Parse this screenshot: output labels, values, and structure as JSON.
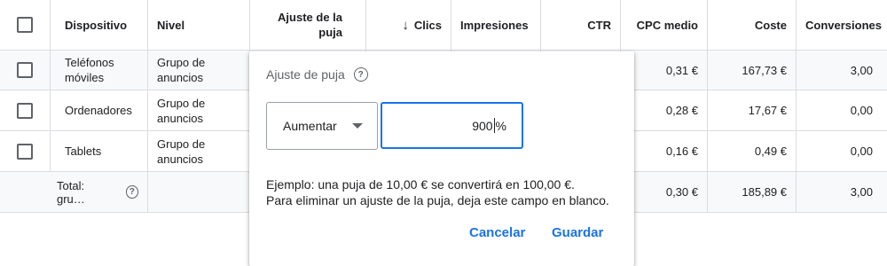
{
  "header": {
    "device": "Dispositivo",
    "level": "Nivel",
    "bid_adjustment_line1": "Ajuste de la",
    "bid_adjustment_line2": "puja",
    "sort_arrow": "↓",
    "clicks": "Clics",
    "impressions": "Impresiones",
    "ctr": "CTR",
    "avg_cpc": "CPC medio",
    "cost": "Coste",
    "conversions": "Conversiones"
  },
  "rows": [
    {
      "device_line1": "Teléfonos",
      "device_line2": "móviles",
      "level_line1": "Grupo de",
      "level_line2": "anuncios",
      "avg_cpc": "0,31 €",
      "cost": "167,73 €",
      "conversions": "3,00"
    },
    {
      "device": "Ordenadores",
      "level_line1": "Grupo de",
      "level_line2": "anuncios",
      "avg_cpc": "0,28 €",
      "cost": "17,67 €",
      "conversions": "0,00"
    },
    {
      "device": "Tablets",
      "level_line1": "Grupo de",
      "level_line2": "anuncios",
      "avg_cpc": "0,16 €",
      "cost": "0,49 €",
      "conversions": "0,00"
    }
  ],
  "total": {
    "label": "Total: gru…",
    "avg_cpc": "0,30 €",
    "cost": "185,89 €",
    "conversions": "3,00"
  },
  "popup": {
    "title": "Ajuste de puja",
    "mode": "Aumentar",
    "value": "900",
    "unit": "%",
    "example_line1": "Ejemplo: una puja de 10,00 € se convertirá en 100,00 €.",
    "example_line2": "Para eliminar un ajuste de la puja, deja este campo en blanco.",
    "cancel": "Cancelar",
    "save": "Guardar"
  },
  "icons": {
    "help": "help-circle-icon",
    "caret": "caret-down-icon",
    "sort": "arrow-down-icon"
  },
  "colors": {
    "accent": "#1a73e8",
    "border": "#dadce0",
    "row_alt": "#f8f9fa"
  }
}
